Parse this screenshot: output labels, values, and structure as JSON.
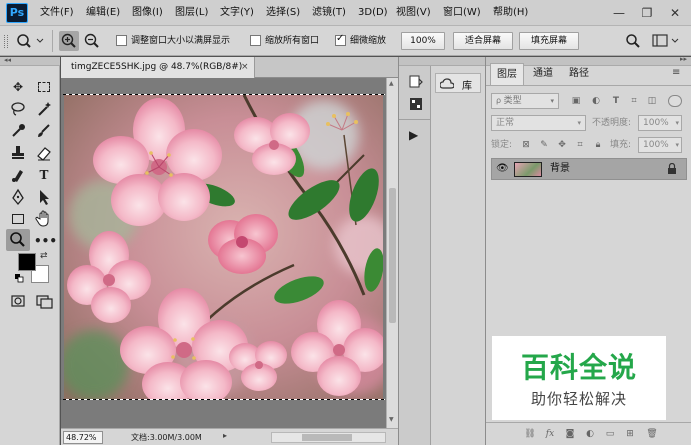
{
  "app": {
    "logo_text": "Ps"
  },
  "menu": {
    "items": [
      "文件(F)",
      "编辑(E)",
      "图像(I)",
      "图层(L)",
      "文字(Y)",
      "选择(S)",
      "滤镜(T)",
      "3D(D)",
      "视图(V)",
      "窗口(W)",
      "帮助(H)"
    ]
  },
  "window_controls": {
    "minimize": "—",
    "restore": "❐",
    "close": "✕"
  },
  "options": {
    "resize_windows_label": "调整窗口大小以满屏显示",
    "resize_windows_checked": false,
    "zoom_all_label": "缩放所有窗口",
    "zoom_all_checked": false,
    "scrubby_zoom_label": "细微缩放",
    "scrubby_zoom_checked": true,
    "zoom_100_label": "100%",
    "fit_screen_label": "适合屏幕",
    "fill_screen_label": "填充屏幕"
  },
  "document": {
    "tab_title": "timgZECE5SHK.jpg @ 48.7%(RGB/8#)",
    "close_glyph": "×",
    "zoom_value": "48.72%",
    "doc_info": "文档:3.00M/3.00M"
  },
  "colors": {
    "foreground": "#000000",
    "background": "#ffffff",
    "watermark_green": "#24a74a"
  },
  "library": {
    "label": "库"
  },
  "layers_panel": {
    "tabs": [
      "图层",
      "通道",
      "路径"
    ],
    "active_tab": "图层",
    "filter_placeholder": "类型",
    "blend_mode": "正常",
    "opacity_label": "不透明度:",
    "opacity_value": "100%",
    "lock_label": "锁定:",
    "fill_label": "填充:",
    "fill_value": "100%",
    "layers": [
      {
        "name": "背景",
        "visible": true,
        "locked": true
      }
    ]
  },
  "watermark": {
    "title": "百科全说",
    "subtitle": "助你轻松解决"
  }
}
